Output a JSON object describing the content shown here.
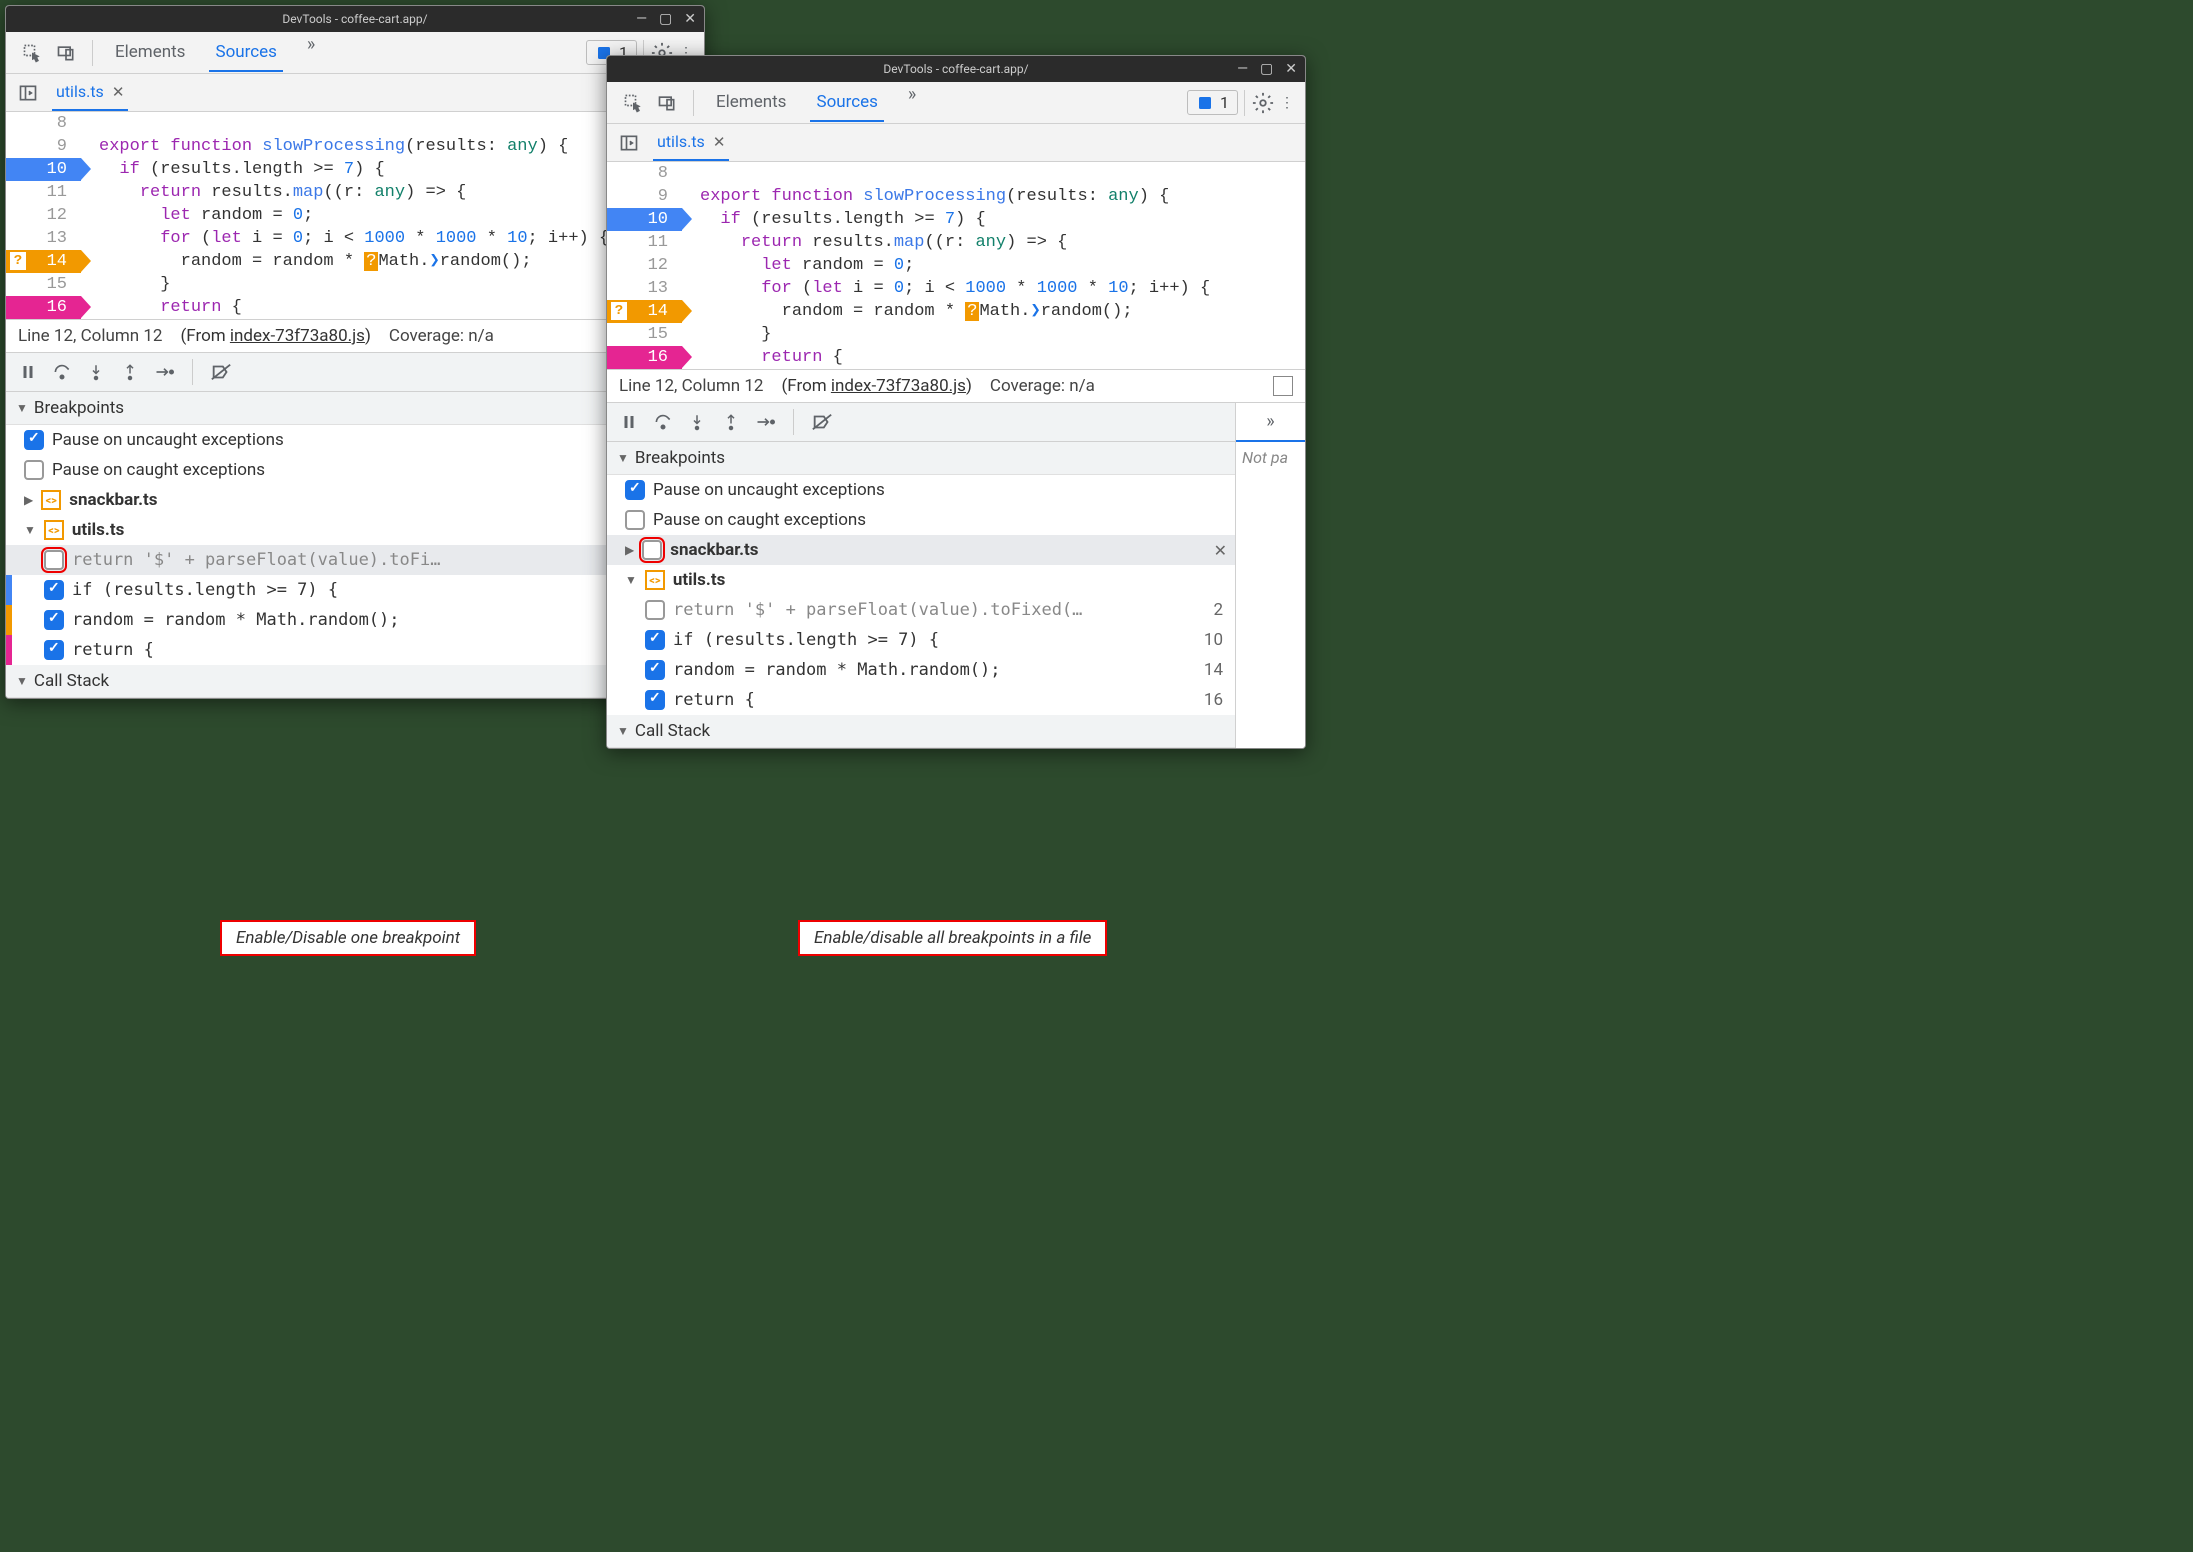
{
  "title": "DevTools - coffee-cart.app/",
  "tabs": {
    "elements": "Elements",
    "sources": "Sources"
  },
  "issues_count": "1",
  "filetab": "utils.ts",
  "code_lines": [
    {
      "n": "8",
      "txt": ""
    },
    {
      "n": "9",
      "txt_html": "<span class='kw'>export</span> <span class='kw'>function</span> <span class='ident'>slowProcessing</span>(<span>results</span>: <span class='type'>any</span>) {"
    },
    {
      "n": "10",
      "bp": "blue",
      "txt_html": "  <span class='kw'>if</span> (results.length &gt;= <span class='num'>7</span>) {"
    },
    {
      "n": "11",
      "txt_html": "    <span class='kw'>return</span> results.<span class='ident'>map</span>((<span>r</span>: <span class='type'>any</span>) =&gt; {"
    },
    {
      "n": "12",
      "txt_html": "      <span class='kw'>let</span> random = <span class='num'>0</span>;"
    },
    {
      "n": "13",
      "txt_html": "      <span class='kw'>for</span> (<span class='kw'>let</span> i = <span class='num'>0</span>; i &lt; <span class='num'>1000</span> * <span class='num'>1000</span> * <span class='num'>10</span>; i++) {"
    },
    {
      "n": "14",
      "bp": "orange",
      "q": true,
      "txt_html": "        random = random * <span class='math-hl'>?</span>Math.<span class='paren-hl'>❯</span>random();"
    },
    {
      "n": "15",
      "txt_html": "      }"
    },
    {
      "n": "16",
      "bp": "pink",
      "txt_html": "      <span class='kw'>return</span> {"
    }
  ],
  "status": {
    "pos": "Line 12, Column 12",
    "from_label": "(From ",
    "from_file": "index-73f73a80.js",
    "coverage": "Coverage: n/a"
  },
  "breakpoints_hdr": "Breakpoints",
  "pause_uncaught": "Pause on uncaught exceptions",
  "pause_caught": "Pause on caught exceptions",
  "files": {
    "snackbar": "snackbar.ts",
    "utils": "utils.ts"
  },
  "bps_w1": [
    {
      "checked": false,
      "red": true,
      "code": "return '$' + parseFloat(value).toFi…",
      "line": "2",
      "edit": true
    },
    {
      "checked": true,
      "code": "if (results.length >= 7) {",
      "line": "10",
      "color": "#4285f4"
    },
    {
      "checked": true,
      "code": "random = random * Math.random();",
      "line": "14",
      "color": "#f29900"
    },
    {
      "checked": true,
      "code": "return {",
      "line": "16",
      "color": "#e52592"
    }
  ],
  "bps_w2": [
    {
      "checked": false,
      "code": "return '$' + parseFloat(value).toFixed(…",
      "line": "2"
    },
    {
      "checked": true,
      "code": "if (results.length >= 7) {",
      "line": "10"
    },
    {
      "checked": true,
      "code": "random = random * Math.random();",
      "line": "14"
    },
    {
      "checked": true,
      "code": "return {",
      "line": "16"
    }
  ],
  "callstack": "Call Stack",
  "sidepane_txt": "Not pa",
  "annot1": "Enable/Disable one breakpoint",
  "annot2": "Enable/disable all breakpoints in a file"
}
